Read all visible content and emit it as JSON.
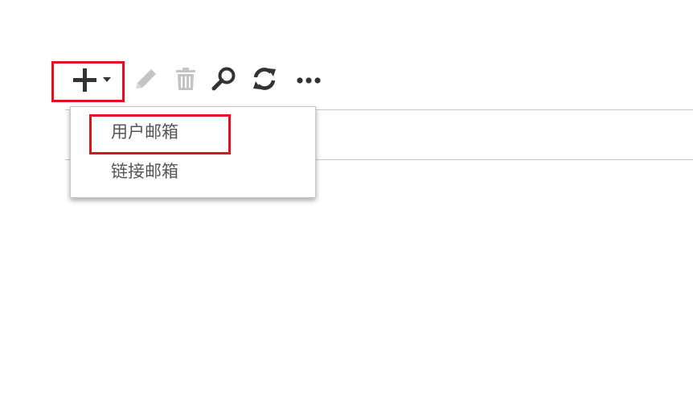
{
  "toolbar": {
    "buttons": [
      {
        "name": "add",
        "icon": "plus-icon",
        "has_dropdown": true,
        "enabled": true
      },
      {
        "name": "edit",
        "icon": "pencil-icon",
        "enabled": false
      },
      {
        "name": "delete",
        "icon": "trash-icon",
        "enabled": false
      },
      {
        "name": "search",
        "icon": "search-icon",
        "enabled": true
      },
      {
        "name": "refresh",
        "icon": "refresh-icon",
        "enabled": true
      },
      {
        "name": "more",
        "icon": "more-icon",
        "enabled": true
      }
    ]
  },
  "add_menu": {
    "items": [
      {
        "label": "用户邮箱"
      },
      {
        "label": "链接邮箱"
      }
    ]
  },
  "colors": {
    "highlight": "#e3101f",
    "icon_active": "#333333",
    "icon_disabled": "#c4c4c4",
    "menu_text": "#555555",
    "divider": "#c8c8c8"
  }
}
